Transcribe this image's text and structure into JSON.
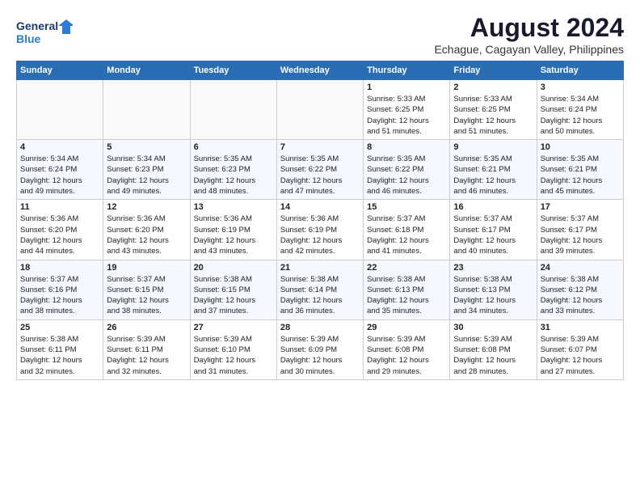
{
  "logo": {
    "line1": "General",
    "line2": "Blue"
  },
  "title": "August 2024",
  "subtitle": "Echague, Cagayan Valley, Philippines",
  "headers": [
    "Sunday",
    "Monday",
    "Tuesday",
    "Wednesday",
    "Thursday",
    "Friday",
    "Saturday"
  ],
  "weeks": [
    [
      {
        "day": "",
        "content": ""
      },
      {
        "day": "",
        "content": ""
      },
      {
        "day": "",
        "content": ""
      },
      {
        "day": "",
        "content": ""
      },
      {
        "day": "1",
        "content": "Sunrise: 5:33 AM\nSunset: 6:25 PM\nDaylight: 12 hours\nand 51 minutes."
      },
      {
        "day": "2",
        "content": "Sunrise: 5:33 AM\nSunset: 6:25 PM\nDaylight: 12 hours\nand 51 minutes."
      },
      {
        "day": "3",
        "content": "Sunrise: 5:34 AM\nSunset: 6:24 PM\nDaylight: 12 hours\nand 50 minutes."
      }
    ],
    [
      {
        "day": "4",
        "content": "Sunrise: 5:34 AM\nSunset: 6:24 PM\nDaylight: 12 hours\nand 49 minutes."
      },
      {
        "day": "5",
        "content": "Sunrise: 5:34 AM\nSunset: 6:23 PM\nDaylight: 12 hours\nand 49 minutes."
      },
      {
        "day": "6",
        "content": "Sunrise: 5:35 AM\nSunset: 6:23 PM\nDaylight: 12 hours\nand 48 minutes."
      },
      {
        "day": "7",
        "content": "Sunrise: 5:35 AM\nSunset: 6:22 PM\nDaylight: 12 hours\nand 47 minutes."
      },
      {
        "day": "8",
        "content": "Sunrise: 5:35 AM\nSunset: 6:22 PM\nDaylight: 12 hours\nand 46 minutes."
      },
      {
        "day": "9",
        "content": "Sunrise: 5:35 AM\nSunset: 6:21 PM\nDaylight: 12 hours\nand 46 minutes."
      },
      {
        "day": "10",
        "content": "Sunrise: 5:35 AM\nSunset: 6:21 PM\nDaylight: 12 hours\nand 45 minutes."
      }
    ],
    [
      {
        "day": "11",
        "content": "Sunrise: 5:36 AM\nSunset: 6:20 PM\nDaylight: 12 hours\nand 44 minutes."
      },
      {
        "day": "12",
        "content": "Sunrise: 5:36 AM\nSunset: 6:20 PM\nDaylight: 12 hours\nand 43 minutes."
      },
      {
        "day": "13",
        "content": "Sunrise: 5:36 AM\nSunset: 6:19 PM\nDaylight: 12 hours\nand 43 minutes."
      },
      {
        "day": "14",
        "content": "Sunrise: 5:36 AM\nSunset: 6:19 PM\nDaylight: 12 hours\nand 42 minutes."
      },
      {
        "day": "15",
        "content": "Sunrise: 5:37 AM\nSunset: 6:18 PM\nDaylight: 12 hours\nand 41 minutes."
      },
      {
        "day": "16",
        "content": "Sunrise: 5:37 AM\nSunset: 6:17 PM\nDaylight: 12 hours\nand 40 minutes."
      },
      {
        "day": "17",
        "content": "Sunrise: 5:37 AM\nSunset: 6:17 PM\nDaylight: 12 hours\nand 39 minutes."
      }
    ],
    [
      {
        "day": "18",
        "content": "Sunrise: 5:37 AM\nSunset: 6:16 PM\nDaylight: 12 hours\nand 38 minutes."
      },
      {
        "day": "19",
        "content": "Sunrise: 5:37 AM\nSunset: 6:15 PM\nDaylight: 12 hours\nand 38 minutes."
      },
      {
        "day": "20",
        "content": "Sunrise: 5:38 AM\nSunset: 6:15 PM\nDaylight: 12 hours\nand 37 minutes."
      },
      {
        "day": "21",
        "content": "Sunrise: 5:38 AM\nSunset: 6:14 PM\nDaylight: 12 hours\nand 36 minutes."
      },
      {
        "day": "22",
        "content": "Sunrise: 5:38 AM\nSunset: 6:13 PM\nDaylight: 12 hours\nand 35 minutes."
      },
      {
        "day": "23",
        "content": "Sunrise: 5:38 AM\nSunset: 6:13 PM\nDaylight: 12 hours\nand 34 minutes."
      },
      {
        "day": "24",
        "content": "Sunrise: 5:38 AM\nSunset: 6:12 PM\nDaylight: 12 hours\nand 33 minutes."
      }
    ],
    [
      {
        "day": "25",
        "content": "Sunrise: 5:38 AM\nSunset: 6:11 PM\nDaylight: 12 hours\nand 32 minutes."
      },
      {
        "day": "26",
        "content": "Sunrise: 5:39 AM\nSunset: 6:11 PM\nDaylight: 12 hours\nand 32 minutes."
      },
      {
        "day": "27",
        "content": "Sunrise: 5:39 AM\nSunset: 6:10 PM\nDaylight: 12 hours\nand 31 minutes."
      },
      {
        "day": "28",
        "content": "Sunrise: 5:39 AM\nSunset: 6:09 PM\nDaylight: 12 hours\nand 30 minutes."
      },
      {
        "day": "29",
        "content": "Sunrise: 5:39 AM\nSunset: 6:08 PM\nDaylight: 12 hours\nand 29 minutes."
      },
      {
        "day": "30",
        "content": "Sunrise: 5:39 AM\nSunset: 6:08 PM\nDaylight: 12 hours\nand 28 minutes."
      },
      {
        "day": "31",
        "content": "Sunrise: 5:39 AM\nSunset: 6:07 PM\nDaylight: 12 hours\nand 27 minutes."
      }
    ]
  ]
}
